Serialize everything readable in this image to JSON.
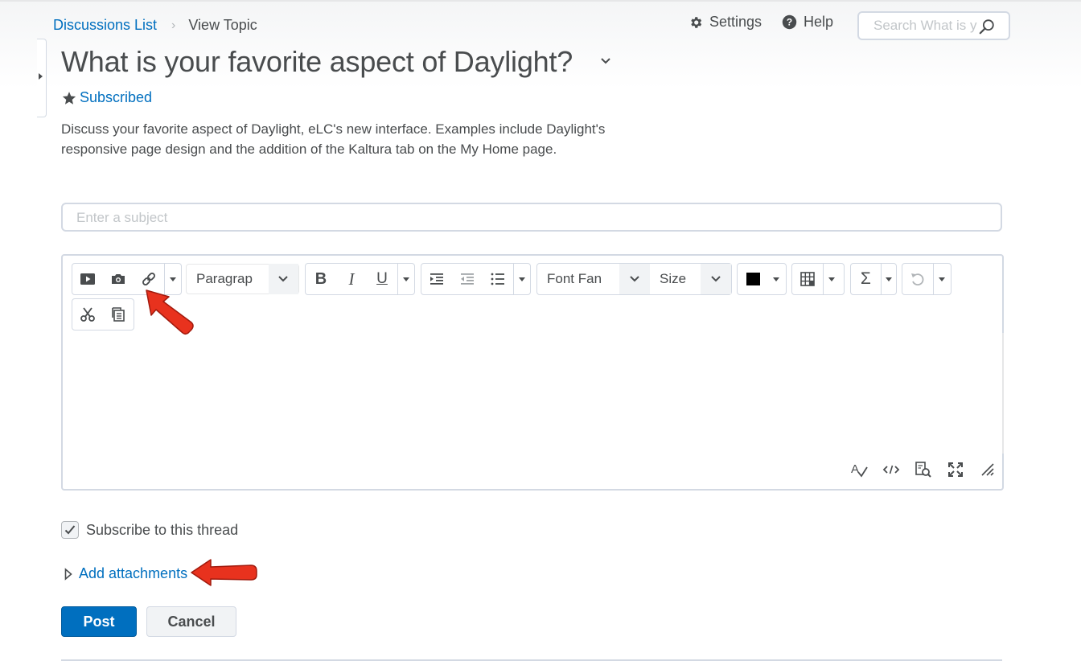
{
  "breadcrumb": {
    "parent": "Discussions List",
    "separator": "›",
    "current": "View Topic"
  },
  "header": {
    "settings_label": "Settings",
    "help_label": "Help",
    "search_placeholder": "Search What is y"
  },
  "topic": {
    "title": "What is your favorite aspect of Daylight?",
    "subscribed_label": "Subscribed",
    "description": "Discuss your favorite aspect of Daylight, eLC's new interface. Examples include Daylight's responsive page design and the addition of the Kaltura tab on the My Home page."
  },
  "form": {
    "subject_placeholder": "Enter a subject",
    "toolbar": {
      "format_select": "Paragrap",
      "font_family_select": "Font Fan",
      "font_size_select": "Size",
      "bold": "B",
      "italic": "I",
      "underline": "U",
      "equation": "Σ",
      "text_color": "#000000"
    },
    "subscribe_label": "Subscribe to this thread",
    "subscribe_checked": true,
    "attachments_label": "Add attachments",
    "post_label": "Post",
    "cancel_label": "Cancel"
  },
  "colors": {
    "link": "#006fbf",
    "primary_button": "#006fbf",
    "border": "#d3d9e3",
    "text": "#494c4e",
    "annotation_arrow": "#e8321e"
  },
  "icons": {
    "toolbar": [
      "video-icon",
      "camera-icon",
      "link-icon",
      "indent-icon",
      "outdent-icon",
      "bullet-list-icon",
      "table-icon",
      "undo-icon",
      "cut-icon",
      "paste-icon"
    ],
    "editor_footer": [
      "spellcheck-icon",
      "source-code-icon",
      "preview-icon",
      "fullscreen-icon",
      "resize-icon"
    ]
  }
}
